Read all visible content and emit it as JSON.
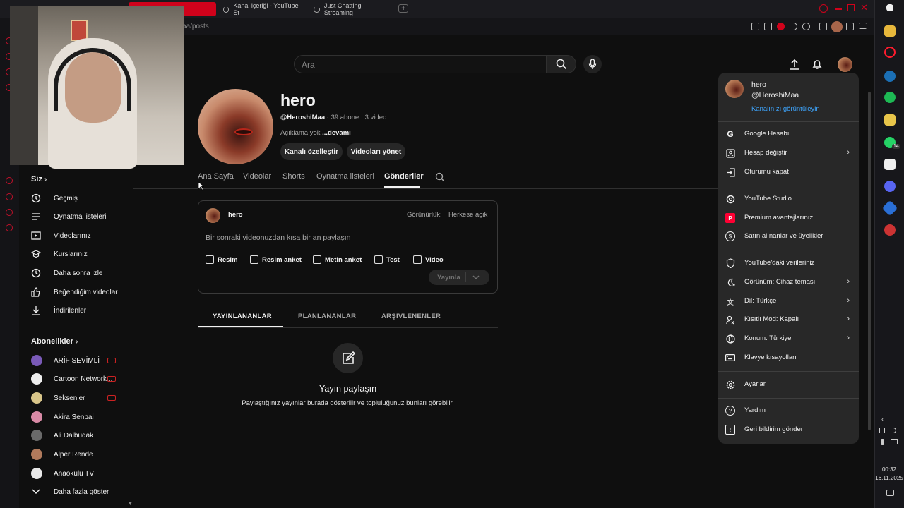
{
  "browser": {
    "tabs": [
      {
        "label": ""
      },
      {
        "label": "Kanal içeriği - YouTube St"
      },
      {
        "label": "Just Chatting Streaming"
      }
    ],
    "new_tab": "+",
    "url": "aa/posts"
  },
  "header": {
    "search_placeholder": "Ara"
  },
  "sidebar": {
    "you_header": "Siz",
    "you_items": [
      {
        "label": "Geçmiş",
        "icon": "history-icon"
      },
      {
        "label": "Oynatma listeleri",
        "icon": "playlist-icon"
      },
      {
        "label": "Videolarınız",
        "icon": "video-icon"
      },
      {
        "label": "Kurslarınız",
        "icon": "course-icon"
      },
      {
        "label": "Daha sonra izle",
        "icon": "clock-icon"
      },
      {
        "label": "Beğendiğim videolar",
        "icon": "thumbs-up-icon"
      },
      {
        "label": "İndirilenler",
        "icon": "download-icon"
      }
    ],
    "subs_header": "Abonelikler",
    "subs": [
      {
        "label": "ARİF SEVİMLİ",
        "live": true,
        "color": "#7a5ab8"
      },
      {
        "label": "Cartoon Network...",
        "live": true,
        "color": "#eeeeee"
      },
      {
        "label": "Seksenler",
        "live": true,
        "color": "#d9c68a"
      },
      {
        "label": "Akira Senpai",
        "live": false,
        "color": "#d98aa6"
      },
      {
        "label": "Ali Dalbudak",
        "live": false,
        "color": "#6a6a6a"
      },
      {
        "label": "Alper Rende",
        "live": false,
        "color": "#b07a5c"
      },
      {
        "label": "Anaokulu TV",
        "live": false,
        "color": "#e8e8e8"
      }
    ],
    "show_more": "Daha fazla göster"
  },
  "channel": {
    "name": "hero",
    "handle": "@HeroshiMaa",
    "meta": " · 39 abone · 3 video",
    "desc": "Açıklama yok ",
    "more": "...devamı",
    "btn_customize": "Kanalı özelleştir",
    "btn_manage": "Videoları yönet",
    "tabs": [
      "Ana Sayfa",
      "Videolar",
      "Shorts",
      "Oynatma listeleri",
      "Gönderiler"
    ],
    "active_tab": "Gönderiler"
  },
  "post": {
    "user": "hero",
    "visibility_label": "Görünürlük:",
    "visibility_value": "Herkese açık",
    "prompt": "Bir sonraki videonuzdan kısa bir an paylaşın",
    "actions": [
      "Resim",
      "Resim anket",
      "Metin anket",
      "Test",
      "Video"
    ],
    "publish": "Yayınla"
  },
  "subtabs": [
    "YAYINLANANLAR",
    "PLANLANANLAR",
    "ARŞİVLENENLER"
  ],
  "empty": {
    "title": "Yayın paylaşın",
    "desc": "Paylaştığınız yayınlar burada gösterilir ve topluluğunuz bunları görebilir."
  },
  "menu": {
    "name": "hero",
    "handle": "@HeroshiMaa",
    "view_channel": "Kanalınızı görüntüleyin",
    "items": [
      {
        "label": "Google Hesabı",
        "icon": "google-icon",
        "chev": false
      },
      {
        "label": "Hesap değiştir",
        "icon": "switch-account-icon",
        "chev": true
      },
      {
        "label": "Oturumu kapat",
        "icon": "sign-out-icon",
        "chev": false
      },
      {
        "label": "YouTube Studio",
        "icon": "studio-icon",
        "chev": false
      },
      {
        "label": "Premium avantajlarınız",
        "icon": "premium-icon",
        "chev": false
      },
      {
        "label": "Satın alınanlar ve üyelikler",
        "icon": "dollar-icon",
        "chev": false
      },
      {
        "label": "YouTube'daki verileriniz",
        "icon": "shield-icon",
        "chev": false
      },
      {
        "label": "Görünüm: Cihaz teması",
        "icon": "moon-icon",
        "chev": true
      },
      {
        "label": "Dil: Türkçe",
        "icon": "translate-icon",
        "chev": true
      },
      {
        "label": "Kısıtlı Mod: Kapalı",
        "icon": "restricted-icon",
        "chev": true
      },
      {
        "label": "Konum: Türkiye",
        "icon": "globe-icon",
        "chev": true
      },
      {
        "label": "Klavye kısayolları",
        "icon": "keyboard-icon",
        "chev": false
      },
      {
        "label": "Ayarlar",
        "icon": "gear-icon",
        "chev": false
      },
      {
        "label": "Yardım",
        "icon": "help-icon",
        "chev": false
      },
      {
        "label": "Geri bildirim gönder",
        "icon": "feedback-icon",
        "chev": false
      }
    ]
  },
  "clock": {
    "time": "00:32",
    "date": "16.11.2025"
  },
  "taskbar": {
    "whatsapp_badge": "14"
  },
  "colors": {
    "accent": "#3ea6ff",
    "brand": "#ff0033",
    "bg": "#0f0f0f"
  }
}
